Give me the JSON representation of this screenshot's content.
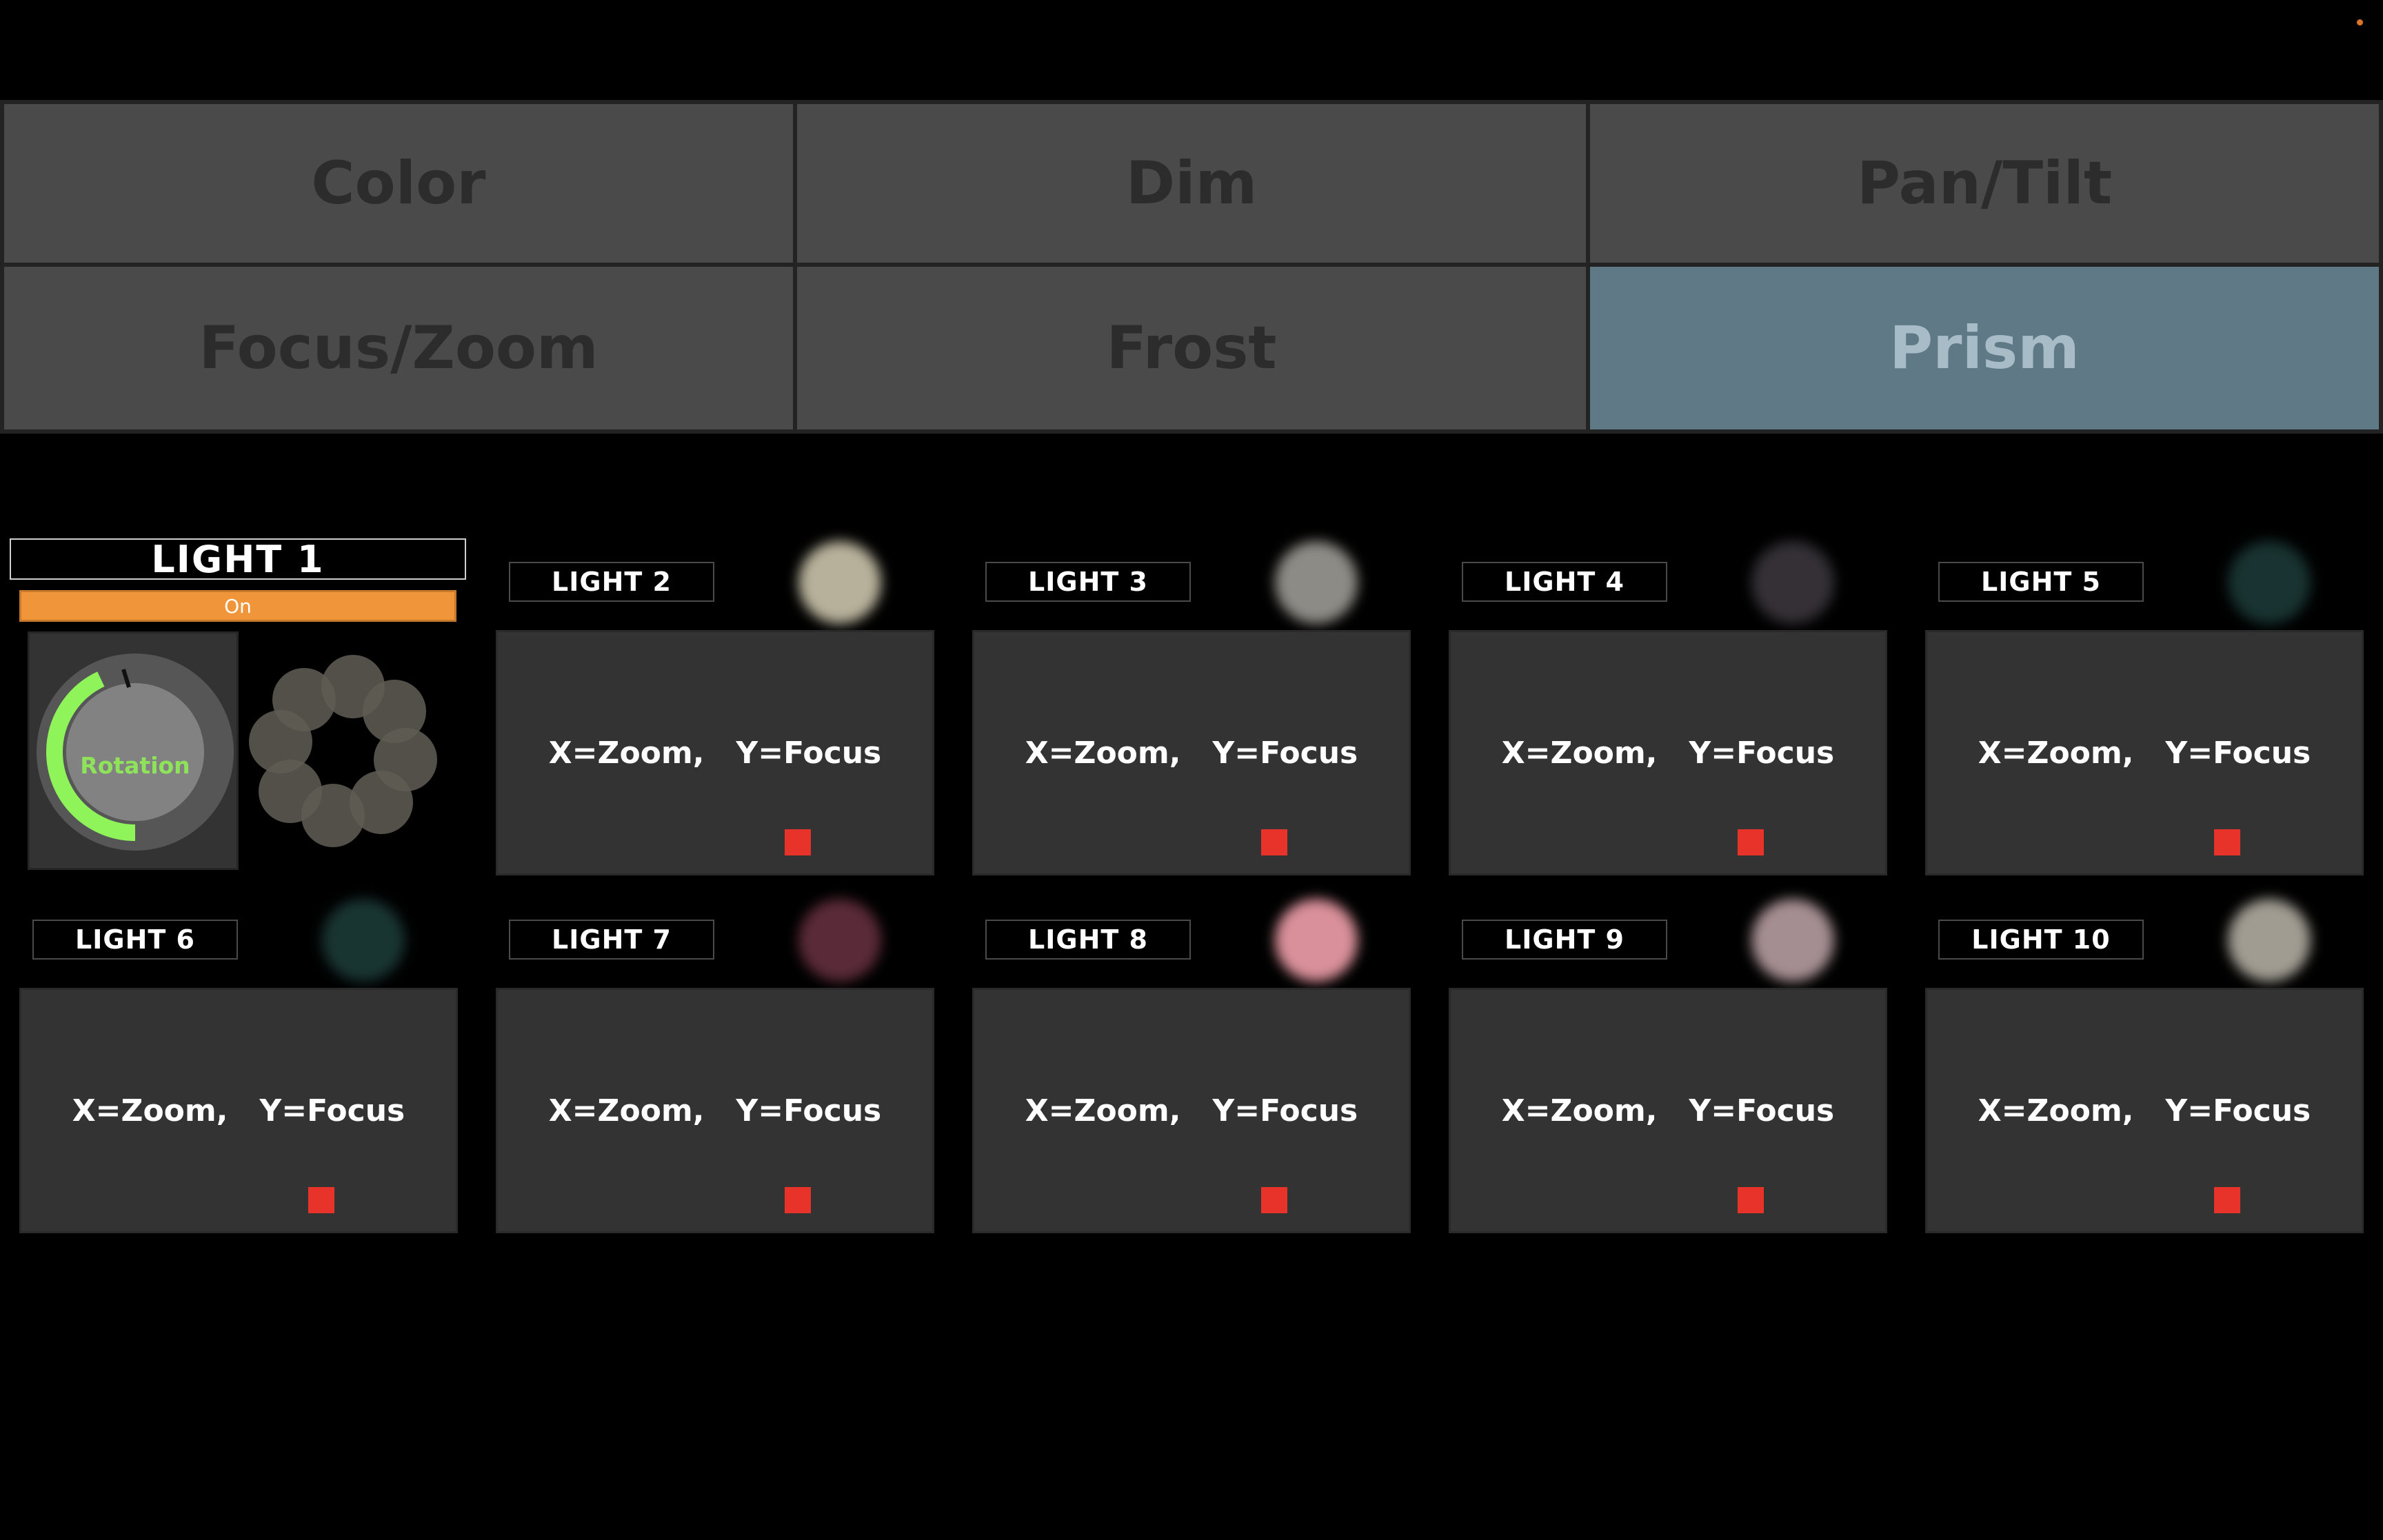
{
  "tabs": [
    {
      "label": "Color",
      "active": false
    },
    {
      "label": "Dim",
      "active": false
    },
    {
      "label": "Pan/Tilt",
      "active": false
    },
    {
      "label": "Focus/Zoom",
      "active": false
    },
    {
      "label": "Frost",
      "active": false
    },
    {
      "label": "Prism",
      "active": true
    }
  ],
  "light1": {
    "title": "LIGHT 1",
    "state_label": "On",
    "knob_label": "Rotation",
    "rotation_fraction": 0.43,
    "knob_color": "#8ff35a"
  },
  "lights": [
    {
      "label": "LIGHT 2",
      "swatch_color": "#b7b19b",
      "pad_label": "X=Zoom,   Y=Focus"
    },
    {
      "label": "LIGHT 3",
      "swatch_color": "#8d8b85",
      "pad_label": "X=Zoom,   Y=Focus"
    },
    {
      "label": "LIGHT 4",
      "swatch_color": "#343036",
      "pad_label": "X=Zoom,   Y=Focus"
    },
    {
      "label": "LIGHT 5",
      "swatch_color": "#183331",
      "pad_label": "X=Zoom,   Y=Focus"
    },
    {
      "label": "LIGHT 6",
      "swatch_color": "#193532",
      "pad_label": "X=Zoom,   Y=Focus"
    },
    {
      "label": "LIGHT 7",
      "swatch_color": "#5a2a38",
      "pad_label": "X=Zoom,   Y=Focus"
    },
    {
      "label": "LIGHT 8",
      "swatch_color": "#d9909a",
      "pad_label": "X=Zoom,   Y=Focus"
    },
    {
      "label": "LIGHT 9",
      "swatch_color": "#a58e92",
      "pad_label": "X=Zoom,   Y=Focus"
    },
    {
      "label": "LIGHT 10",
      "swatch_color": "#a09c92",
      "pad_label": "X=Zoom,   Y=Focus"
    }
  ],
  "colors": {
    "active_tab": "#5f7987",
    "on_indicator": "#f0953a",
    "pad_marker": "#e8332a"
  }
}
